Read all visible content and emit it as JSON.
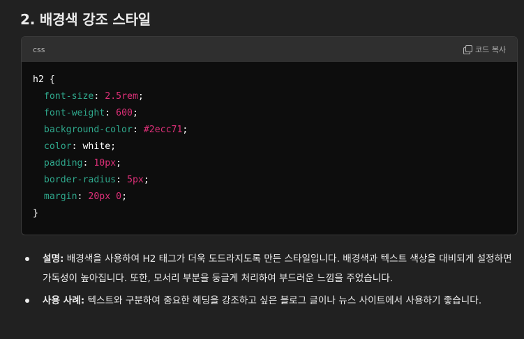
{
  "heading": "2. 배경색 강조 스타일",
  "code": {
    "language": "css",
    "copy_label": "코드 복사",
    "copy_icon": "copy-icon",
    "colors": {
      "property": "#2fa88c",
      "value": "#df3079",
      "plain": "#ffffff",
      "header_bg": "#2f2f2f",
      "body_bg": "#0d0d0d"
    },
    "lines": [
      [
        {
          "t": "plain",
          "s": "h2 {"
        }
      ],
      [
        {
          "t": "plain",
          "s": "  "
        },
        {
          "t": "prop",
          "s": "font-size"
        },
        {
          "t": "plain",
          "s": ": "
        },
        {
          "t": "val",
          "s": "2.5rem"
        },
        {
          "t": "plain",
          "s": ";"
        }
      ],
      [
        {
          "t": "plain",
          "s": "  "
        },
        {
          "t": "prop",
          "s": "font-weight"
        },
        {
          "t": "plain",
          "s": ": "
        },
        {
          "t": "val",
          "s": "600"
        },
        {
          "t": "plain",
          "s": ";"
        }
      ],
      [
        {
          "t": "plain",
          "s": "  "
        },
        {
          "t": "prop",
          "s": "background-color"
        },
        {
          "t": "plain",
          "s": ": "
        },
        {
          "t": "val",
          "s": "#2ecc71"
        },
        {
          "t": "plain",
          "s": ";"
        }
      ],
      [
        {
          "t": "plain",
          "s": "  "
        },
        {
          "t": "prop",
          "s": "color"
        },
        {
          "t": "plain",
          "s": ": white;"
        }
      ],
      [
        {
          "t": "plain",
          "s": "  "
        },
        {
          "t": "prop",
          "s": "padding"
        },
        {
          "t": "plain",
          "s": ": "
        },
        {
          "t": "val",
          "s": "10px"
        },
        {
          "t": "plain",
          "s": ";"
        }
      ],
      [
        {
          "t": "plain",
          "s": "  "
        },
        {
          "t": "prop",
          "s": "border-radius"
        },
        {
          "t": "plain",
          "s": ": "
        },
        {
          "t": "val",
          "s": "5px"
        },
        {
          "t": "plain",
          "s": ";"
        }
      ],
      [
        {
          "t": "plain",
          "s": "  "
        },
        {
          "t": "prop",
          "s": "margin"
        },
        {
          "t": "plain",
          "s": ": "
        },
        {
          "t": "val",
          "s": "20px 0"
        },
        {
          "t": "plain",
          "s": ";"
        }
      ],
      [
        {
          "t": "plain",
          "s": "}"
        }
      ]
    ]
  },
  "bullets": [
    {
      "label": "설명:",
      "text": "배경색을 사용하여 H2 태그가 더욱 도드라지도록 만든 스타일입니다. 배경색과 텍스트 색상을 대비되게 설정하면 가독성이 높아집니다. 또한, 모서리 부분을 둥글게 처리하여 부드러운 느낌을 주었습니다."
    },
    {
      "label": "사용 사례:",
      "text": "텍스트와 구분하여 중요한 헤딩을 강조하고 싶은 블로그 글이나 뉴스 사이트에서 사용하기 좋습니다."
    }
  ]
}
